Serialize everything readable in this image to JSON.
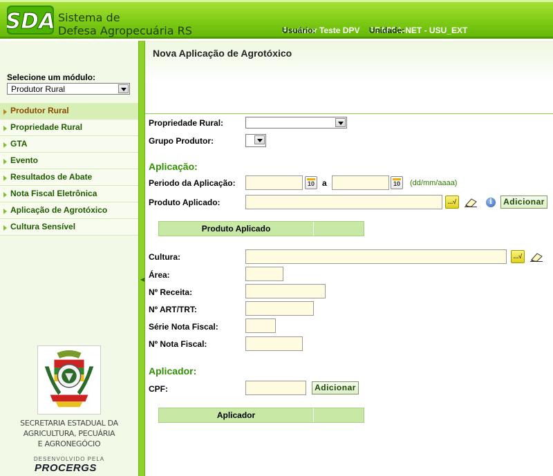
{
  "header": {
    "logo_text": "SDA",
    "system_name_line1": "Sistema de",
    "system_name_line2": "Defesa Agropecuária RS",
    "user_label": "Usuário:",
    "user_value": "Produtor Teste DPV",
    "unit_label": "Unidade:",
    "unit_value": "SEAPPA-NET - USU_EXT"
  },
  "sidebar": {
    "module_label": "Selecione um módulo:",
    "module_selected": "Produtor Rural",
    "items": [
      {
        "label": "Produtor Rural",
        "active": true
      },
      {
        "label": "Propriedade Rural",
        "active": false
      },
      {
        "label": "GTA",
        "active": false
      },
      {
        "label": "Evento",
        "active": false
      },
      {
        "label": "Resultados de Abate",
        "active": false
      },
      {
        "label": "Nota Fiscal Eletrônica",
        "active": false
      },
      {
        "label": "Aplicação de Agrotóxico",
        "active": false
      },
      {
        "label": "Cultura Sensível",
        "active": false
      }
    ],
    "secretaria_line1": "SECRETARIA ESTADUAL DA",
    "secretaria_line2": "AGRICULTURA, PECUÁRIA",
    "secretaria_line3": "E AGRONEGÓCIO",
    "developed_by": "DESENVOLVIDO PELA",
    "procergs": "PROCERGS"
  },
  "main": {
    "title": "Nova Aplicação de Agrotóxico",
    "propriedade_rural_label": "Propriedade Rural:",
    "grupo_produtor_label": "Grupo Produtor:",
    "aplicacao_section": "Aplicação:",
    "periodo_label": "Periodo da Aplicação:",
    "periodo_sep": "a",
    "date_hint": "(dd/mm/aaaa)",
    "calendar_day": "10",
    "lookup_glyph": "...√",
    "info_glyph": "i",
    "produto_aplicado_label": "Produto Aplicado:",
    "adicionar_label": "Adicionar",
    "produto_table_header": "Produto Aplicado",
    "cultura_label": "Cultura:",
    "area_label": "Área:",
    "receita_label": "Nº Receita:",
    "art_label": "Nº ART/TRT:",
    "serie_label": "Série Nota Fiscal:",
    "nota_label": "Nº Nota Fiscal:",
    "aplicador_section": "Aplicador:",
    "cpf_label": "CPF:",
    "aplicador_table_header": "Aplicador"
  },
  "colors": {
    "header_green": "#80cc16",
    "section_green": "#2f8f00",
    "field_bg": "#fffbe0",
    "table_header": "#c8e9a6",
    "active_menu_text": "#8a4a00"
  }
}
